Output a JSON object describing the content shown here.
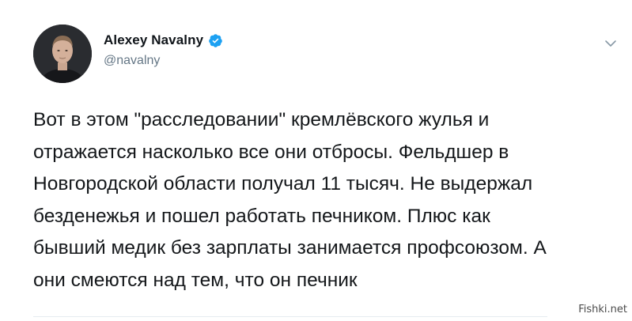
{
  "author": {
    "display_name": "Alexey Navalny",
    "handle": "@navalny",
    "verified": true,
    "avatar_icon": "profile-photo",
    "verified_icon": "verified-badge-icon",
    "verified_color": "#1da1f2"
  },
  "menu": {
    "icon": "chevron-down-icon"
  },
  "tweet": {
    "lines": [
      "Вот в этом \"расследовании\" кремлёвского жулья и",
      "отражается насколько все они отбросы. Фельдшер в",
      "Новгородской области получал 11 тысяч. Не выдержал",
      "безденежья и пошел работать печником. Плюс как",
      "бывший медик без зарплаты занимается профсоюзом. А",
      "они смеются над тем, что он печник"
    ]
  },
  "watermark": {
    "text": "Fishki.net"
  }
}
